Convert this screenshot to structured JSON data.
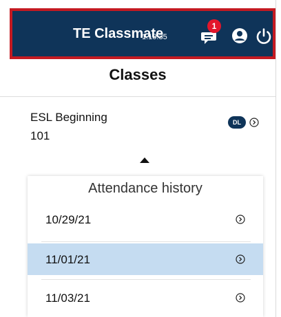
{
  "header": {
    "app_name": "TE Classmate",
    "version": "1.10.35",
    "notification_count": "1",
    "icons": [
      "chat-icon",
      "account-icon",
      "power-icon"
    ],
    "bg_color": "#0f3459",
    "highlight_border_color": "#c41a22"
  },
  "page": {
    "title": "Classes"
  },
  "classes": [
    {
      "name_line1": "ESL Beginning",
      "name_line2": "101",
      "badge": "DL"
    }
  ],
  "attendance": {
    "title": "Attendance history",
    "items": [
      {
        "date": "10/29/21",
        "selected": false
      },
      {
        "date": "11/01/21",
        "selected": true
      },
      {
        "date": "11/03/21",
        "selected": false
      }
    ],
    "selected_color": "#c5dcf1"
  }
}
